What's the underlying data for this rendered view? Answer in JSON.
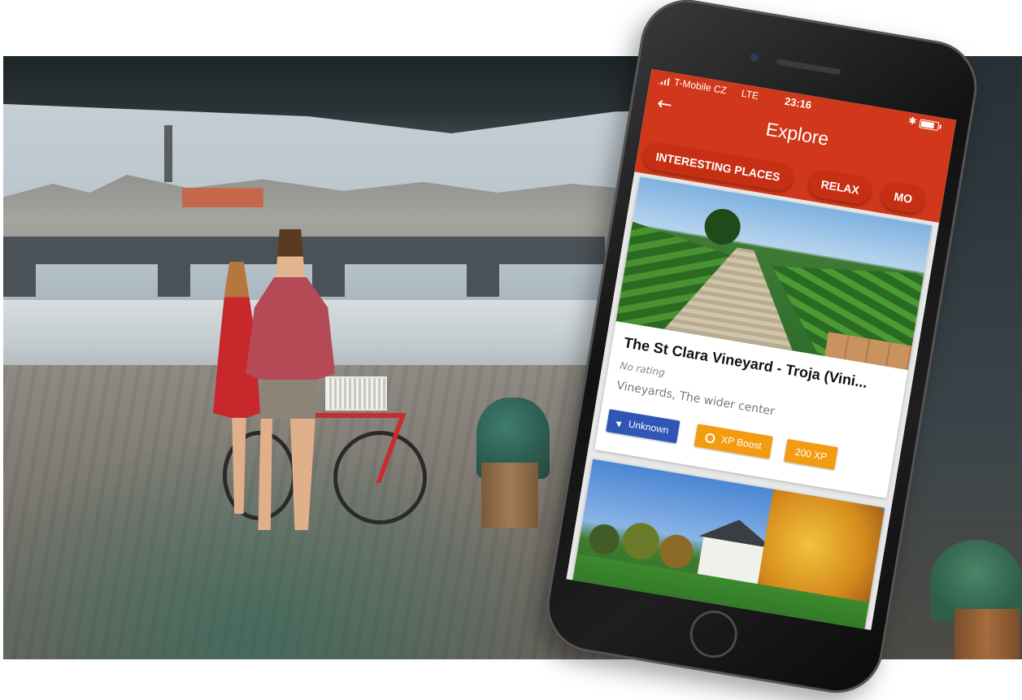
{
  "status_bar": {
    "carrier": "T-Mobile CZ",
    "network": "LTE",
    "time": "23:16"
  },
  "header": {
    "back_icon": "←",
    "title": "Explore"
  },
  "chips": [
    {
      "label": "INTERESTING PLACES"
    },
    {
      "label": "RELAX"
    },
    {
      "label": "MO"
    }
  ],
  "place_card": {
    "title": "The St Clara Vineyard - Troja (Vini...",
    "rating": "No rating",
    "category": "Vineyards, The wider center",
    "distance_label": "Unknown",
    "boost_label": "XP Boost",
    "xp_label": "200 XP"
  },
  "colors": {
    "header_red": "#d1381b",
    "chip_red": "#c72f14",
    "badge_blue": "#2f55b5",
    "badge_orange": "#f39c12"
  },
  "icons": {
    "back": "arrow-left-icon",
    "signal": "signal-bars-icon",
    "bluetooth": "bluetooth-icon",
    "battery": "battery-icon",
    "navigation": "navigation-arrow-icon",
    "boost": "boost-circle-icon"
  }
}
